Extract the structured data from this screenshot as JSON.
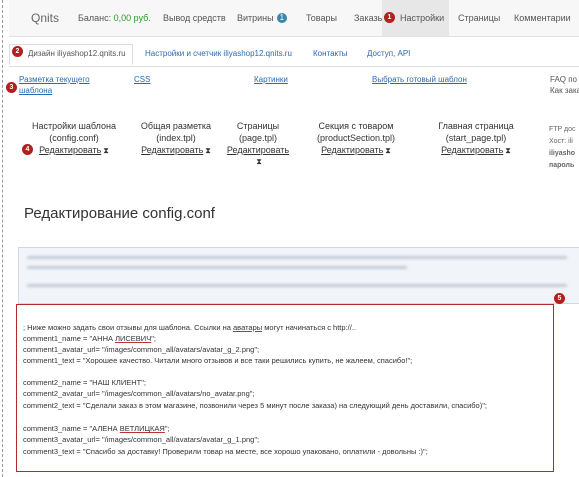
{
  "nav": {
    "logo": "Qnits",
    "balance_label": "Баланс:",
    "balance_value": "0,00 руб.",
    "withdraw": "Вывод средств",
    "showcases": "Витрины",
    "showcases_count": "1",
    "goods": "Товары",
    "orders": "Заказы",
    "settings": "Настройки",
    "pages": "Страницы",
    "comments": "Комментарии"
  },
  "markers": [
    "1",
    "2",
    "3",
    "4",
    "5"
  ],
  "tabs": {
    "design": "Дизайн iliyashop12.qnits.ru",
    "settings_counters": "Настройки и счетчик iliyashop12.qnits.ru",
    "contacts": "Контакты",
    "access": "Доступ, API"
  },
  "row_links": {
    "current_markup_1": "Разметка текущего",
    "current_markup_2": "шаблона",
    "css": "CSS",
    "images": "Картинки",
    "choose_template": "Выбрать готовый шаблон",
    "faq_1": "FAQ по",
    "faq_2": "Как зака"
  },
  "columns": [
    {
      "title": "Настройки шаблона",
      "file": "(config.conf)",
      "edit": "Редактировать"
    },
    {
      "title": "Общая разметка",
      "file": "(index.tpl)",
      "edit": "Редактировать"
    },
    {
      "title": "Страницы",
      "file": "(page.tpl)",
      "edit": "Редактировать"
    },
    {
      "title": "Секция с товаром",
      "file": "(productSection.tpl)",
      "edit": "Редактировать"
    },
    {
      "title": "Главная страница",
      "file": "(start_page.tpl)",
      "edit": "Редактировать"
    }
  ],
  "hourglass_glyph": "⧗",
  "ftp": {
    "line1": "FTP дос",
    "line2": "Хост: ili",
    "line3": "iliyasho",
    "line4": "пароль"
  },
  "heading": "Редактирование config.conf",
  "code_lines": {
    "l1_a": "; Ниже можно задать свои отзывы для шаблона. Ссылки на ",
    "l1_b": "аватары",
    "l1_c": " могут начинаться с http://..",
    "l2_a": "comment1_name = \"АННА ",
    "l2_b": "ЛИСЕВИЧ",
    "l2_c": "\";",
    "l3": "comment1_avatar_url= \"/images/common_all/avatars/avatar_g_2.png\";",
    "l4": "comment1_text = \"Хорошее качество. Читали много отзывов и все таки решились купить, не жалеем, спасибо!\";",
    "l5": "comment2_name = \"НАШ КЛИЕНТ\";",
    "l6": "comment2_avatar_url= \"/images/common_all/avatars/no_avatar.png\";",
    "l7": "comment2_text = \"Сделали заказ в этом магазине, позвонили через 5 минут после заказа) на следующий день доставили, спасибо)\";",
    "l8_a": "comment3_name = \"АЛЕНА ",
    "l8_b": "ВЕТЛИЦКАЯ",
    "l8_c": "\";",
    "l9": "comment3_avatar_url= \"/images/common_all/avatars/avatar_g_1.png\";",
    "l10": "comment3_text = \"Спасибо за доставку! Проверили товар на месте, все хорошо упаковано, оплатили - довольны :)\";"
  }
}
